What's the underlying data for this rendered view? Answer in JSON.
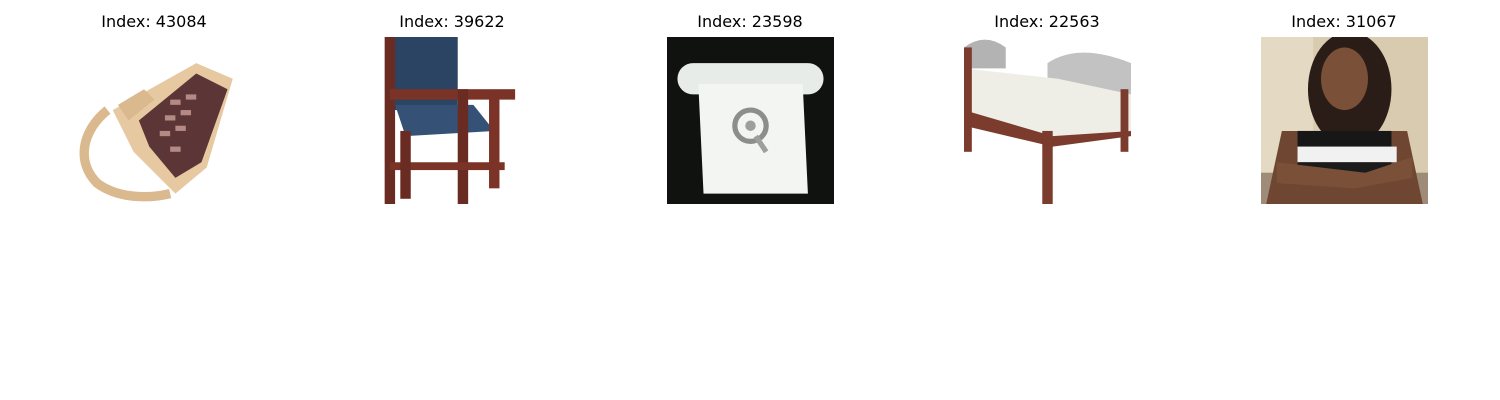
{
  "panels": [
    {
      "title": "Index: 43084",
      "subject": "telephone",
      "background": "#ffffff"
    },
    {
      "title": "Index: 39622",
      "subject": "chair",
      "background": "#ffffff"
    },
    {
      "title": "Index: 23598",
      "subject": "telephone",
      "background": "#0f120f"
    },
    {
      "title": "Index: 22563",
      "subject": "bed",
      "background": "#ffffff"
    },
    {
      "title": "Index: 31067",
      "subject": "person",
      "background": "#d9cbb0"
    }
  ]
}
